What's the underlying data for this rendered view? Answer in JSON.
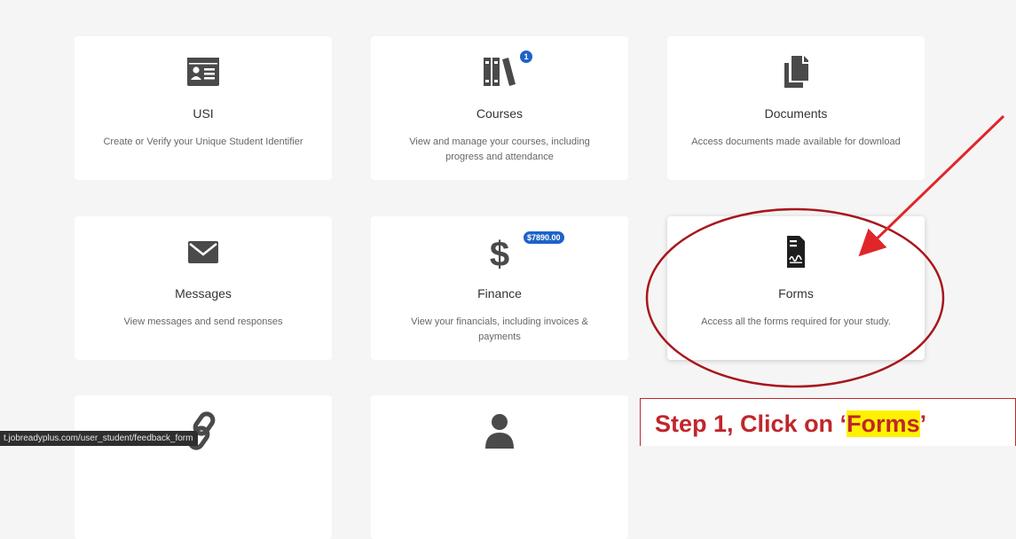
{
  "cards": {
    "usi": {
      "title": "USI",
      "desc": "Create or Verify your Unique Student Identifier",
      "icon": "id-card-icon"
    },
    "courses": {
      "title": "Courses",
      "desc": "View and manage your courses, including progress and attendance",
      "badge": "1",
      "icon": "books-icon"
    },
    "documents": {
      "title": "Documents",
      "desc": "Access documents made available for download",
      "icon": "documents-icon"
    },
    "messages": {
      "title": "Messages",
      "desc": "View messages and send responses",
      "icon": "envelope-icon"
    },
    "finance": {
      "title": "Finance",
      "desc": "View your financials, including invoices & payments",
      "badge": "$7890.00",
      "icon": "dollar-icon"
    },
    "forms": {
      "title": "Forms",
      "desc": "Access all the forms required for your study.",
      "icon": "form-signature-icon"
    },
    "row3_left": {
      "icon": "link-icon"
    },
    "row3_middle": {
      "icon": "user-icon"
    }
  },
  "status_bar": {
    "url": "t.jobreadyplus.com/user_student/feedback_form"
  },
  "annotation": {
    "prefix": "Step 1, Click on ‘",
    "highlight": "Forms",
    "suffix": "’"
  },
  "colors": {
    "page_bg": "#f5f5f5",
    "card_bg": "#ffffff",
    "icon": "#4a4a4a",
    "badge": "#1e63c7",
    "annotation_red": "#c0262b",
    "highlight": "#fff200"
  }
}
